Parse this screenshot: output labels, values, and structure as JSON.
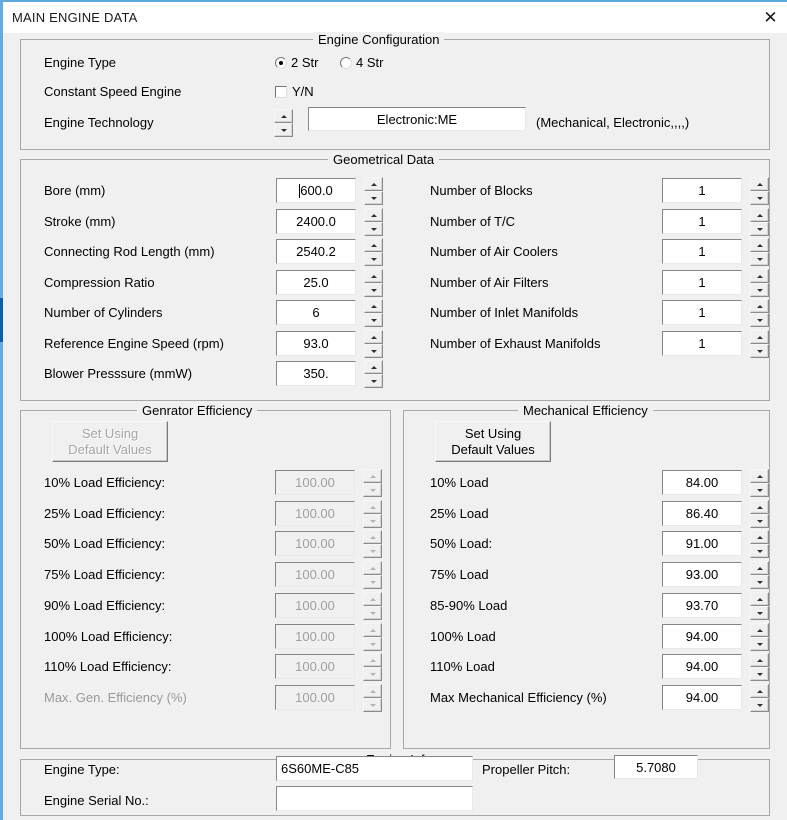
{
  "window": {
    "title": "MAIN ENGINE DATA",
    "close_label": "✕",
    "accent_color": "#5ca8dd",
    "scroll_thumb_color": "#0a5fab",
    "face_color": "#f0f0f0"
  },
  "engine_configuration": {
    "title": "Engine Configuration",
    "engine_type_label": "Engine Type",
    "radio_2str_label": "2 Str",
    "radio_4str_label": "4 Str",
    "radio_selected": "2 Str",
    "constant_speed_label": "Constant Speed Engine",
    "constant_speed_checkbox_label": "Y/N",
    "constant_speed_checked": false,
    "engine_technology_label": "Engine Technology",
    "engine_technology_value": "Electronic:ME",
    "engine_technology_hint": "(Mechanical, Electronic,,,,)"
  },
  "geometrical_data": {
    "title": "Geometrical Data",
    "left_rows": [
      {
        "label": "Bore (mm)",
        "value": "600.0",
        "caret": true
      },
      {
        "label": "Stroke (mm)",
        "value": "2400.0",
        "caret": false
      },
      {
        "label": "Connecting Rod Length (mm)",
        "value": "2540.2",
        "caret": false
      },
      {
        "label": "Compression Ratio",
        "value": "25.0",
        "caret": false
      },
      {
        "label": "Number of Cylinders",
        "value": "6",
        "caret": false
      },
      {
        "label": "Reference Engine Speed (rpm)",
        "value": "93.0",
        "caret": false
      },
      {
        "label": "Blower Presssure (mmW)",
        "value": "350.",
        "caret": false
      }
    ],
    "right_rows": [
      {
        "label": "Number of Blocks",
        "value": "1"
      },
      {
        "label": "Number of T/C",
        "value": "1"
      },
      {
        "label": "Number of Air Coolers",
        "value": "1"
      },
      {
        "label": "Number of Air Filters",
        "value": "1"
      },
      {
        "label": "Number of Inlet Manifolds",
        "value": "1"
      },
      {
        "label": "Number of Exhaust  Manifolds",
        "value": "1"
      }
    ]
  },
  "generator_efficiency": {
    "title": "Genrator Efficiency",
    "default_button_line1": "Set Using",
    "default_button_line2": "Default Values",
    "disabled": true,
    "rows": [
      {
        "label": "10% Load Efficiency:",
        "value": "100.00"
      },
      {
        "label": "25% Load Efficiency:",
        "value": "100.00"
      },
      {
        "label": "50% Load Efficiency:",
        "value": "100.00"
      },
      {
        "label": "75% Load Efficiency:",
        "value": "100.00"
      },
      {
        "label": "90% Load Efficiency:",
        "value": "100.00"
      },
      {
        "label": "100% Load Efficiency:",
        "value": "100.00"
      },
      {
        "label": "110% Load Efficiency:",
        "value": "100.00"
      },
      {
        "label": "Max. Gen. Efficiency (%)",
        "value": "100.00"
      }
    ]
  },
  "mechanical_efficiency": {
    "title": "Mechanical Efficiency",
    "default_button_line1": "Set Using",
    "default_button_line2": "Default Values",
    "disabled": false,
    "rows": [
      {
        "label": "10% Load",
        "value": "84.00"
      },
      {
        "label": "25% Load",
        "value": "86.40"
      },
      {
        "label": "50% Load:",
        "value": "91.00"
      },
      {
        "label": "75% Load",
        "value": "93.00"
      },
      {
        "label": "85-90% Load",
        "value": "93.70"
      },
      {
        "label": "100% Load",
        "value": "94.00"
      },
      {
        "label": "110% Load",
        "value": "94.00"
      },
      {
        "label": "Max Mechanical Efficiency (%)",
        "value": "94.00"
      }
    ]
  },
  "engine_info": {
    "title": "Engine Info:",
    "engine_type_label": "Engine Type:",
    "engine_type_value": "6S60ME-C85",
    "engine_serial_label": "Engine Serial No.:",
    "engine_serial_value": "",
    "propeller_pitch_label": "Propeller Pitch:",
    "propeller_pitch_value": "5.7080"
  }
}
